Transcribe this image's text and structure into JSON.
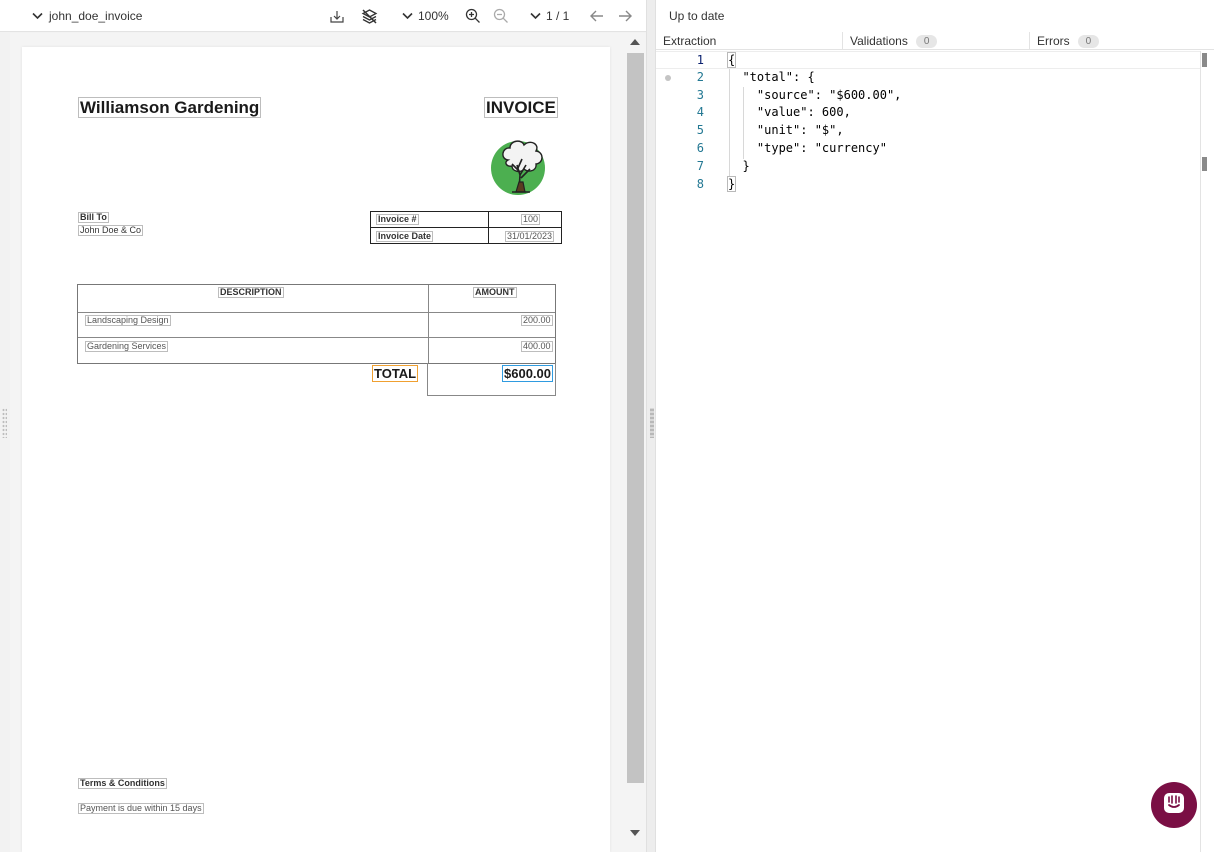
{
  "viewer": {
    "doc_title": "john_doe_invoice",
    "zoom": "100%",
    "page_indicator": "1 / 1"
  },
  "invoice": {
    "company": "Williamson Gardening",
    "heading": "INVOICE",
    "bill_to_label": "Bill To",
    "bill_to_name": "John Doe & Co",
    "meta": [
      {
        "label": "Invoice #",
        "value": "100"
      },
      {
        "label": "Invoice Date",
        "value": "31/01/2023"
      }
    ],
    "table_headers": {
      "description": "DESCRIPTION",
      "amount": "AMOUNT"
    },
    "items": [
      {
        "description": "Landscaping Design",
        "amount": "200.00"
      },
      {
        "description": "Gardening Services",
        "amount": "400.00"
      }
    ],
    "total_label": "TOTAL",
    "total_value": "$600.00",
    "terms_title": "Terms & Conditions",
    "terms_text": "Payment is due within 15 days"
  },
  "panel": {
    "status": "Up to date",
    "tabs": [
      {
        "label": "Extraction"
      },
      {
        "label": "Validations",
        "count": "0"
      },
      {
        "label": "Errors",
        "count": "0"
      }
    ]
  },
  "editor": {
    "lines": [
      {
        "num": "1",
        "text": "{"
      },
      {
        "num": "2",
        "text": "  \"total\": {"
      },
      {
        "num": "3",
        "text": "    \"source\": \"$600.00\","
      },
      {
        "num": "4",
        "text": "    \"value\": 600,"
      },
      {
        "num": "5",
        "text": "    \"unit\": \"$\","
      },
      {
        "num": "6",
        "text": "    \"type\": \"currency\""
      },
      {
        "num": "7",
        "text": "  }"
      },
      {
        "num": "8",
        "text": "}"
      }
    ]
  },
  "icons": {
    "dropdown": "chevron-down-icon",
    "download": "download-icon",
    "layers": "layers-off-icon",
    "zoom_in": "zoom-in-icon",
    "zoom_out": "zoom-out-icon",
    "prev": "arrow-left-icon",
    "next": "arrow-right-icon",
    "chat": "chat-icon",
    "logo": "tree-logo"
  },
  "colors": {
    "accent_chat": "#7a0f44",
    "logo_green": "#4caf50",
    "highlight_total_label": "#f0a030",
    "highlight_total_value": "#2f9be0"
  }
}
